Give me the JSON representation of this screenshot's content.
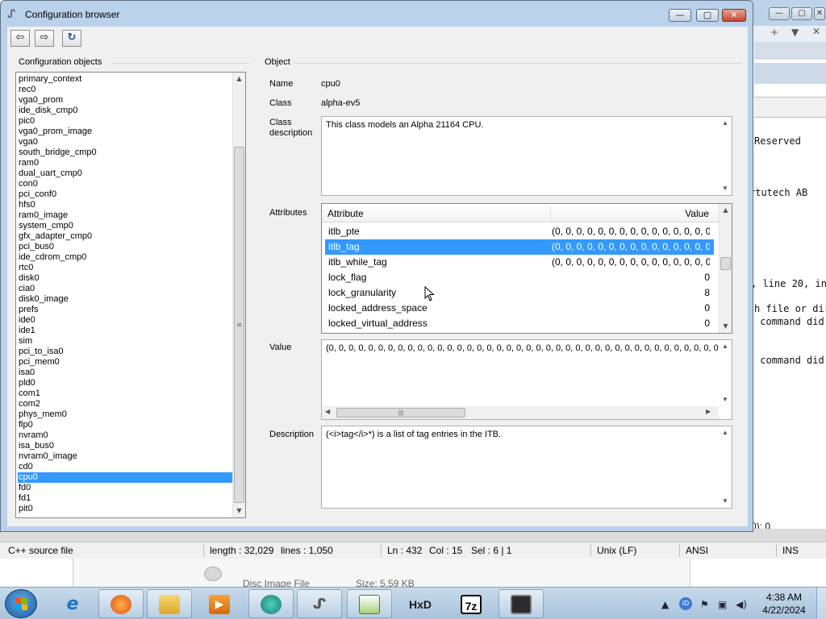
{
  "background_console": {
    "lines": [
      "Reserved",
      "rtutech AB",
      ", line 20, in",
      "h file or dir",
      " command did",
      " command did"
    ],
    "status_tail": "0): 0"
  },
  "background_editor": {
    "status": {
      "file_type": "C++ source file",
      "length": "length : 32,029",
      "lines": "lines : 1,050",
      "ln": "Ln : 432",
      "col": "Col : 15",
      "sel": "Sel : 6 | 1",
      "eol": "Unix (LF)",
      "encoding": "ANSI",
      "mode": "INS"
    },
    "file_row": {
      "name": "Disc Image File",
      "size": "Size: 5.59 KB"
    }
  },
  "window": {
    "title": "Configuration browser",
    "controls": {
      "minimize": "—",
      "maximize": "▢",
      "close": "✕"
    }
  },
  "toolbar": {
    "back_glyph": "⇦",
    "forward_glyph": "⇨",
    "refresh_glyph": "↻"
  },
  "objects_panel": {
    "label": "Configuration objects",
    "items": [
      "primary_context",
      "rec0",
      "vga0_prom",
      "ide_disk_cmp0",
      "pic0",
      "vga0_prom_image",
      "vga0",
      "south_bridge_cmp0",
      "ram0",
      "dual_uart_cmp0",
      "con0",
      "pci_conf0",
      "hfs0",
      "ram0_image",
      "system_cmp0",
      "gfx_adapter_cmp0",
      "pci_bus0",
      "ide_cdrom_cmp0",
      "rtc0",
      "disk0",
      "cia0",
      "disk0_image",
      "prefs",
      "ide0",
      "ide1",
      "sim",
      "pci_to_isa0",
      "pci_mem0",
      "isa0",
      "pld0",
      "com1",
      "com2",
      "phys_mem0",
      "flp0",
      "nvram0",
      "isa_bus0",
      "nvram0_image",
      "cd0",
      "cpu0",
      "fd0",
      "fd1",
      "pit0"
    ],
    "selected": "cpu0"
  },
  "object_panel": {
    "label": "Object",
    "name_label": "Name",
    "name_value": "cpu0",
    "class_label": "Class",
    "class_value": "alpha-ev5",
    "class_desc_label": "Class\ndescription",
    "class_desc_value": "This class models an Alpha 21164 CPU.",
    "attributes_label": "Attributes",
    "attr_columns": {
      "attribute": "Attribute",
      "value": "Value"
    },
    "attributes": [
      {
        "name": "itlb_pte",
        "value": "(0, 0, 0, 0, 0, 0, 0, 0, 0, 0, 0, 0, 0, 0, 0,..."
      },
      {
        "name": "itlb_tag",
        "value": "(0, 0, 0, 0, 0, 0, 0, 0, 0, 0, 0, 0, 0, 0, 0,...",
        "selected": true
      },
      {
        "name": "itlb_while_tag",
        "value": "(0, 0, 0, 0, 0, 0, 0, 0, 0, 0, 0, 0, 0, 0, 0,..."
      },
      {
        "name": "lock_flag",
        "value": "0"
      },
      {
        "name": "lock_granularity",
        "value": "8"
      },
      {
        "name": "locked_address_space",
        "value": "0"
      },
      {
        "name": "locked_virtual_address",
        "value": "0"
      }
    ],
    "value_label": "Value",
    "value_text": "(0, 0, 0, 0, 0, 0, 0, 0, 0, 0, 0, 0, 0, 0, 0, 0, 0, 0, 0, 0, 0, 0, 0, 0, 0, 0, 0, 0, 0, 0, 0, 0, 0, 0, 0, 0, 0, 0, 0, 0, 0, 0, 0, 0, 0, 0, 0, 0",
    "description_label": "Description",
    "description_text": "(<i>tag</i>*) is a list of tag entries in the ITB."
  },
  "taskbar": {
    "apps": [
      "Internet Explorer",
      "Firefox",
      "Windows Explorer",
      "Media Player",
      "App",
      "Simics",
      "Notepad++",
      "HxD",
      "7-Zip",
      "Remote Desktop"
    ],
    "hxd_label": "HxD",
    "sevenzip_label": "7z",
    "clock_time": "4:38 AM",
    "clock_date": "4/22/2024",
    "colors": {
      "selection": "#3399ff",
      "titlebar": "#b9d1ea",
      "taskbar": "#b6cde3"
    }
  }
}
